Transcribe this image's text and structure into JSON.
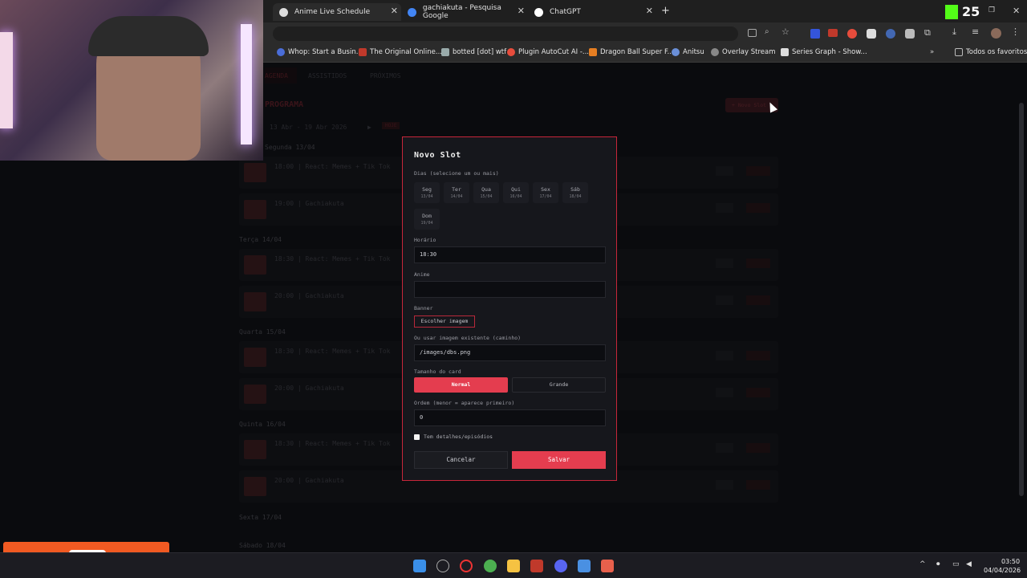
{
  "browser": {
    "tabs": [
      {
        "title": "Anime Live Schedule",
        "active": true
      },
      {
        "title": "gachiakuta - Pesquisa Google",
        "active": false
      },
      {
        "title": "ChatGPT",
        "active": false
      }
    ],
    "bookmarks": [
      "Whop: Start a Busin...",
      "The Original Online...",
      "botted [dot] wtf",
      "Plugin AutoCut AI -...",
      "Dragon Ball Super F...",
      "Anitsu",
      "Overlay Stream",
      "Series Graph - Show..."
    ],
    "favorites_label": "Todos os favoritos",
    "kick_count": "25"
  },
  "app": {
    "tabs": [
      "AGENDA",
      "ASSISTIDOS",
      "PRÓXIMOS"
    ],
    "section_title": "PROGRAMA",
    "week_range": "13 Abr - 19 Abr 2026",
    "today_badge": "HOJE",
    "add_button": "+ Novo Slot",
    "days": [
      {
        "title": "Segunda 13/04",
        "slots": [
          "18:00 | React: Memes + Tik Tok",
          "19:00 | Gachiakuta"
        ]
      },
      {
        "title": "Terça 14/04",
        "slots": [
          "18:30 | React: Memes + Tik Tok",
          "20:00 | Gachiakuta"
        ]
      },
      {
        "title": "Quarta 15/04",
        "slots": [
          "18:30 | React: Memes + Tik Tok",
          "20:00 | Gachiakuta"
        ]
      },
      {
        "title": "Quinta 16/04",
        "slots": [
          "18:30 | React: Memes + Tik Tok",
          "20:00 | Gachiakuta"
        ]
      },
      {
        "title": "Sexta 17/04",
        "slots": []
      },
      {
        "title": "Sábado 18/04",
        "slots": []
      }
    ]
  },
  "modal": {
    "title": "Novo Slot",
    "days_label": "Dias (selecione um ou mais)",
    "day_options": [
      {
        "name": "Seg",
        "date": "13/04"
      },
      {
        "name": "Ter",
        "date": "14/04"
      },
      {
        "name": "Qua",
        "date": "15/04"
      },
      {
        "name": "Qui",
        "date": "16/04"
      },
      {
        "name": "Sex",
        "date": "17/04"
      },
      {
        "name": "Sáb",
        "date": "18/04"
      },
      {
        "name": "Dom",
        "date": "19/04"
      }
    ],
    "time_label": "Horário",
    "time_value": "18:30",
    "anime_label": "Anime",
    "anime_value": "",
    "banner_label": "Banner",
    "choose_image": "Escolher imagem",
    "existing_label": "Ou usar imagem existente (caminho)",
    "existing_value": "/images/dbs.png",
    "size_label": "Tamanho do card",
    "size_normal": "Normal",
    "size_grande": "Grande",
    "order_label": "Ordem (menor = aparece primeiro)",
    "order_value": "0",
    "details_label": "Tem detalhes/episódios",
    "cancel": "Cancelar",
    "save": "Salvar"
  },
  "taskbar": {
    "time": "03:50",
    "date": "04/04/2026"
  },
  "colors": {
    "accent": "#e43d4f",
    "background": "#101116",
    "modal_bg": "#16171c"
  }
}
